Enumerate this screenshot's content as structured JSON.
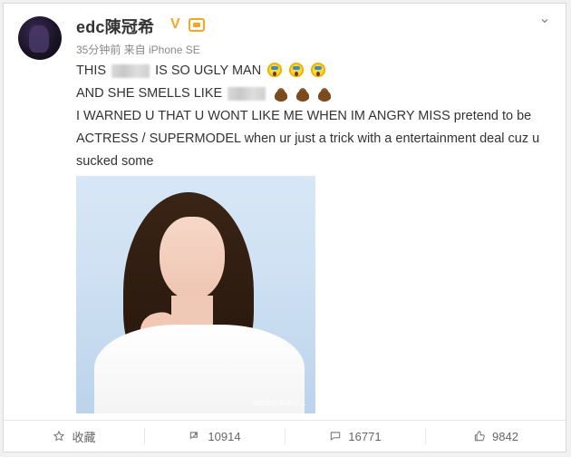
{
  "post": {
    "username": "edc陳冠希",
    "verified_badge": "V",
    "meta": "35分钟前 来自 iPhone SE",
    "lines": {
      "l1_a": "THIS",
      "l1_b": "IS SO UGLY MAN",
      "l2_a": "AND SHE SMELLS LIKE",
      "l3": "I WARNED U THAT U WONT LIKE ME WHEN IM ANGRY MISS pretend to be",
      "l4": "ACTRESS / SUPERMODEL when ur just a trick with a entertainment deal cuz u",
      "l5": "sucked some"
    },
    "icons": {
      "scream": "face-screaming-emoji",
      "poop": "pile-of-poo-emoji",
      "menu": "chevron-down-icon"
    },
    "photo": {
      "watermark": "weibo.com/..."
    }
  },
  "actions": {
    "favorite": "收藏",
    "repost": "10914",
    "comment": "16771",
    "like": "9842"
  },
  "colors": {
    "accent": "#f5a623",
    "text": "#333333",
    "muted": "#888888"
  }
}
